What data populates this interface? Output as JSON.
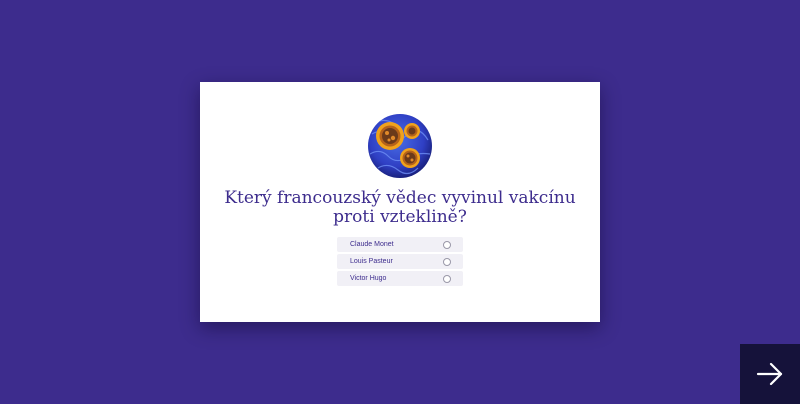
{
  "quiz": {
    "illustration_icon": "virus-cell-icon",
    "question": "Který francouzský vědec vyvinul vakcínu proti vzteklině?",
    "options": [
      {
        "label": "Claude Monet",
        "selected": false
      },
      {
        "label": "Louis Pasteur",
        "selected": false
      },
      {
        "label": "Victor Hugo",
        "selected": false
      }
    ]
  },
  "navigation": {
    "next_icon": "arrow-right-icon"
  },
  "colors": {
    "background": "#3d2c8d",
    "card": "#ffffff",
    "text": "#3d2c8d",
    "option_background": "#f1f0f6",
    "next_button": "#15123a"
  }
}
